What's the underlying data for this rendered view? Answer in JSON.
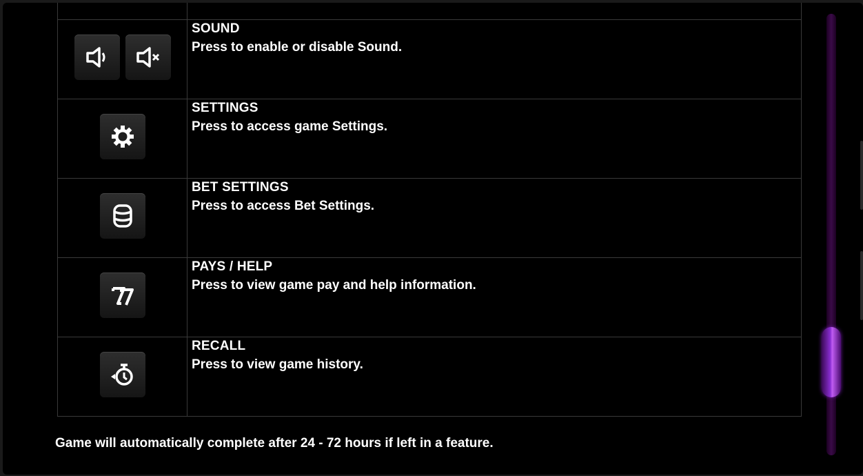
{
  "rows": [
    {
      "title": "SOUND",
      "desc": "Press to enable or disable Sound.",
      "icons": [
        "speaker-on-icon",
        "speaker-mute-icon"
      ]
    },
    {
      "title": "SETTINGS",
      "desc": "Press to access game Settings.",
      "icons": [
        "gear-icon"
      ]
    },
    {
      "title": "BET SETTINGS",
      "desc": "Press to access Bet Settings.",
      "icons": [
        "coin-stack-icon"
      ]
    },
    {
      "title": "PAYS / HELP",
      "desc": "Press to view game pay and help information.",
      "icons": [
        "sevens-icon"
      ]
    },
    {
      "title": "RECALL",
      "desc": "Press to view game history.",
      "icons": [
        "history-clock-icon"
      ]
    }
  ],
  "footer": "Game will automatically complete after 24 - 72 hours if left in a feature.",
  "scrollbar": {
    "position_fraction": 0.82
  },
  "colors": {
    "accent": "#8a2ed3",
    "background": "#000000",
    "border": "#3a3a3a",
    "text": "#ffffff"
  }
}
